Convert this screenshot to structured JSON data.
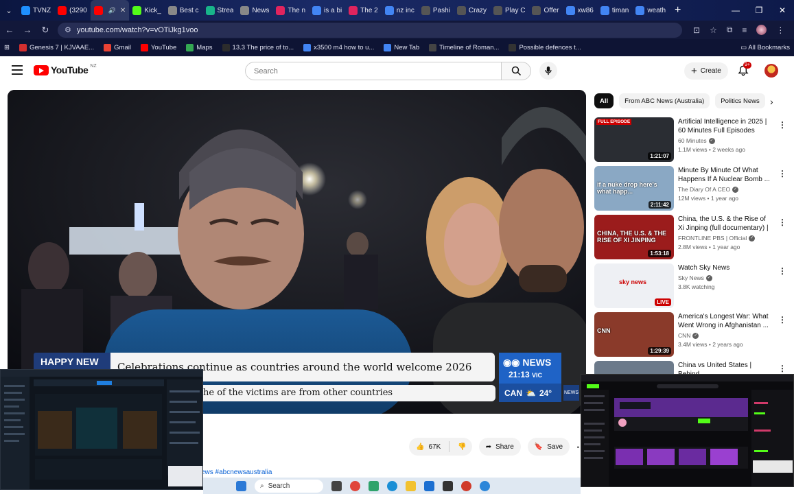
{
  "browser": {
    "tabs": [
      {
        "title": "TVNZ",
        "icon": "plus-icon",
        "color": "#1e90ff"
      },
      {
        "title": "(3290",
        "icon": "youtube-icon",
        "color": "#ff0000"
      },
      {
        "title": "",
        "icon": "youtube-icon",
        "color": "#ff0000",
        "active": true
      },
      {
        "title": "Kick_",
        "icon": "kick-icon",
        "color": "#53fc18"
      },
      {
        "title": "Best c",
        "icon": "tab-icon",
        "color": "#888888"
      },
      {
        "title": "Strea",
        "icon": "tab-icon",
        "color": "#18b48a"
      },
      {
        "title": "News",
        "icon": "tab-icon",
        "color": "#888888"
      },
      {
        "title": "The n",
        "icon": "tab-icon",
        "color": "#e0245e"
      },
      {
        "title": "is a bi",
        "icon": "google-icon",
        "color": "#4285f4"
      },
      {
        "title": "The 2",
        "icon": "tab-icon",
        "color": "#e0245e"
      },
      {
        "title": "nz inc",
        "icon": "google-icon",
        "color": "#4285f4"
      },
      {
        "title": "Pashi",
        "icon": "tab-icon",
        "color": "#555555"
      },
      {
        "title": "Crazy",
        "icon": "tab-icon",
        "color": "#555555"
      },
      {
        "title": "Play C",
        "icon": "tab-icon",
        "color": "#555555"
      },
      {
        "title": "Offer",
        "icon": "tab-icon",
        "color": "#555555"
      },
      {
        "title": "xw86",
        "icon": "google-icon",
        "color": "#4285f4"
      },
      {
        "title": "timan",
        "icon": "google-icon",
        "color": "#4285f4"
      },
      {
        "title": "weath",
        "icon": "google-icon",
        "color": "#4285f4"
      }
    ],
    "url": "youtube.com/watch?v=vOTiJkg1voo",
    "bookmarks": [
      {
        "label": "Genesis 7 | KJVAAE...",
        "color": "#d32f2f"
      },
      {
        "label": "Gmail",
        "color": "#ea4335"
      },
      {
        "label": "YouTube",
        "color": "#ff0000"
      },
      {
        "label": "Maps",
        "color": "#34a853"
      },
      {
        "label": "13.3 The price of to...",
        "color": "#2c2c2c"
      },
      {
        "label": "x3500 m4 how to u...",
        "color": "#4285f4"
      },
      {
        "label": "New Tab",
        "color": "#4285f4"
      },
      {
        "label": "Timeline of Roman...",
        "color": "#444444"
      },
      {
        "label": "Possible defences t...",
        "color": "#333333"
      }
    ],
    "all_bookmarks": "All Bookmarks"
  },
  "youtube": {
    "logo_text": "YouTube",
    "region_code": "NZ",
    "search_placeholder": "Search",
    "create_label": "Create",
    "notification_count": "9+",
    "video": {
      "ticker_tag": "HAPPY NEW",
      "headline": "Celebrations continue as countries around the world welcome 2026",
      "subline": "he of the victims are from other countries",
      "network": "NEWS",
      "time": "21:13",
      "tz": "VIC",
      "weather_city": "CAN",
      "weather_temp": "24°",
      "small_logo": "NEWS"
    },
    "actions": {
      "likes": "67K",
      "share": "Share",
      "save": "Save"
    },
    "hashtag_text": "ews #abcnewsaustralia",
    "chips": [
      "All",
      "From ABC News (Australia)",
      "Politics News"
    ],
    "recommendations": [
      {
        "title": "Artificial Intelligence in 2025 | 60 Minutes Full Episodes",
        "channel": "60 Minutes",
        "verified": true,
        "stats": "1.1M views • 2 weeks ago",
        "duration": "1:21:07",
        "badge": "FULL EPISODE",
        "thumb_color": "#2a2d33"
      },
      {
        "title": "Minute By Minute Of What Happens If A Nuclear Bomb ...",
        "channel": "The Diary Of A CEO",
        "verified": true,
        "stats": "12M views • 1 year ago",
        "duration": "2:11:42",
        "overlay": "if a nuke drop here's what happ...",
        "thumb_color": "#8aa8c4"
      },
      {
        "title": "China, the U.S. & the Rise of Xi Jinping (full documentary) | ...",
        "channel": "FRONTLINE PBS | Official",
        "verified": true,
        "stats": "2.8M views • 1 year ago",
        "duration": "1:53:18",
        "overlay": "CHINA, THE U.S. & THE RISE OF XI JINPING",
        "thumb_color": "#9b1c1c"
      },
      {
        "title": "Watch Sky News",
        "channel": "Sky News",
        "verified": true,
        "stats": "3.8K watching",
        "live": "LIVE",
        "overlay": "sky news",
        "thumb_color": "#eef0f4"
      },
      {
        "title": "America's Longest War: What Went Wrong in Afghanistan ...",
        "channel": "CNN",
        "verified": true,
        "stats": "3.4M views • 2 years ago",
        "duration": "1:29:39",
        "overlay": "CNN",
        "thumb_color": "#8a3a2a"
      },
      {
        "title": "China vs United States | Behind",
        "channel": "",
        "verified": false,
        "stats": "",
        "thumb_color": "#6c7a8a"
      }
    ]
  },
  "overlay_left": {
    "app": "Stake",
    "bottom_text": "Broadcast"
  },
  "overlay_right": {
    "app": "KICK",
    "channel_name": "GoddessHQ",
    "status": "GoddessHQ is offline",
    "section": "Recent Videos"
  },
  "taskbar": {
    "search_label": "Search"
  }
}
